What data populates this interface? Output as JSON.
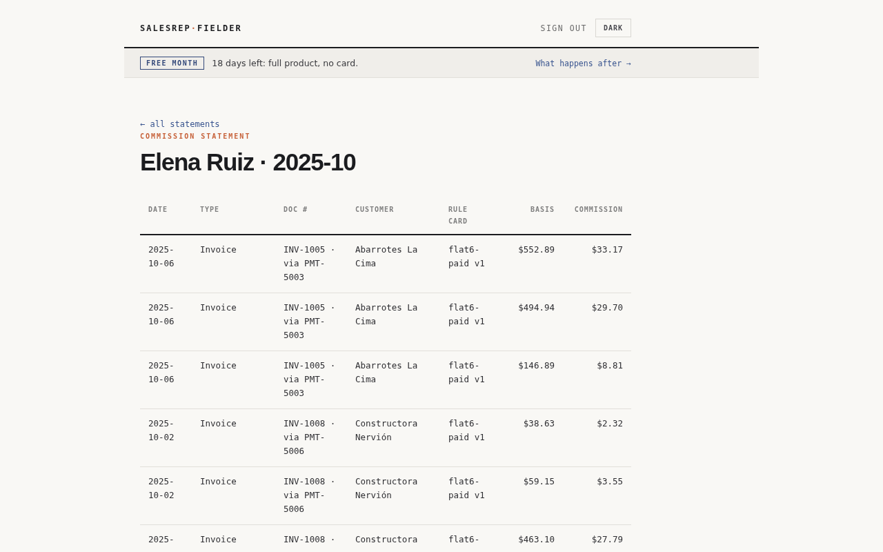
{
  "brand": {
    "left": "SALESREP",
    "separator": "·",
    "right": "FIELDER"
  },
  "nav": {
    "sign_out": "SIGN OUT",
    "theme_button": "DARK"
  },
  "banner": {
    "badge": "FREE MONTH",
    "message": "18 days left: full product, no card.",
    "link": "What happens after →"
  },
  "back_link": "← all statements",
  "eyebrow": "COMMISSION STATEMENT",
  "title": "Elena Ruiz · 2025-10",
  "table": {
    "columns": [
      {
        "label": "DATE",
        "kind": "text"
      },
      {
        "label": "TYPE",
        "kind": "text"
      },
      {
        "label": "DOC #",
        "kind": "text"
      },
      {
        "label": "CUSTOMER",
        "kind": "text"
      },
      {
        "label": "RULE CARD",
        "kind": "text"
      },
      {
        "label": "BASIS",
        "kind": "money"
      },
      {
        "label": "COMMISSION",
        "kind": "money"
      }
    ],
    "rows": [
      {
        "cells": [
          "2025-10-06",
          "Invoice",
          "INV-1005 · via PMT-5003",
          "Abarrotes La Cima",
          "flat6-paid v1",
          "$552.89",
          "$33.17"
        ]
      },
      {
        "cells": [
          "2025-10-06",
          "Invoice",
          "INV-1005 · via PMT-5003",
          "Abarrotes La Cima",
          "flat6-paid v1",
          "$494.94",
          "$29.70"
        ]
      },
      {
        "cells": [
          "2025-10-06",
          "Invoice",
          "INV-1005 · via PMT-5003",
          "Abarrotes La Cima",
          "flat6-paid v1",
          "$146.89",
          "$8.81"
        ]
      },
      {
        "cells": [
          "2025-10-02",
          "Invoice",
          "INV-1008 · via PMT-5006",
          "Constructora Nervión",
          "flat6-paid v1",
          "$38.63",
          "$2.32"
        ]
      },
      {
        "cells": [
          "2025-10-02",
          "Invoice",
          "INV-1008 · via PMT-5006",
          "Constructora Nervión",
          "flat6-paid v1",
          "$59.15",
          "$3.55"
        ]
      },
      {
        "cells": [
          "2025-",
          "Invoice",
          "INV-1008 ·",
          "Constructora",
          "flat6-",
          "$463.10",
          "$27.79"
        ]
      }
    ]
  }
}
